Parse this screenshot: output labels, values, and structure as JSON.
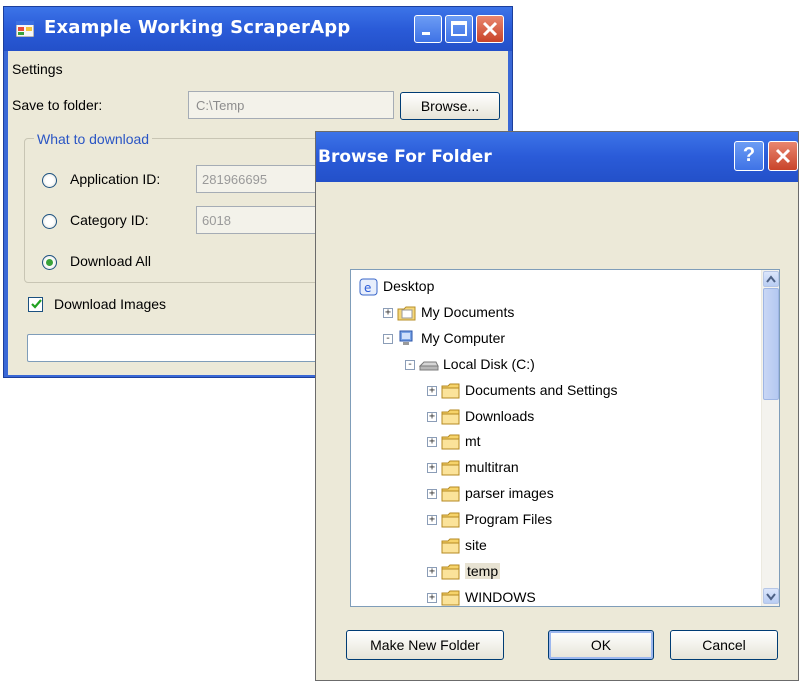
{
  "main_window": {
    "title": "Example Working ScraperApp",
    "menu": {
      "settings": "Settings"
    },
    "save_label": "Save to folder:",
    "save_value": "C:\\Temp",
    "browse_label": "Browse...",
    "group_title": "What to download",
    "options": [
      {
        "label": "Application ID:",
        "value": "281966695",
        "checked": false
      },
      {
        "label": "Category ID:",
        "value": "6018",
        "checked": false
      },
      {
        "label": "Download All",
        "checked": true
      }
    ],
    "download_images_label": "Download Images",
    "download_images_checked": true
  },
  "dialog": {
    "title": "Browse For Folder",
    "help": "?",
    "tree": [
      {
        "label": "Desktop",
        "icon": "desktop-icon",
        "depth": 0,
        "expander": ""
      },
      {
        "label": "My Documents",
        "icon": "my-documents-icon",
        "depth": 1,
        "expander": "+"
      },
      {
        "label": "My Computer",
        "icon": "my-computer-icon",
        "depth": 1,
        "expander": "-"
      },
      {
        "label": "Local Disk (C:)",
        "icon": "drive-icon",
        "depth": 2,
        "expander": "-"
      },
      {
        "label": "Documents and Settings",
        "icon": "folder-icon",
        "depth": 3,
        "expander": "+"
      },
      {
        "label": "Downloads",
        "icon": "folder-icon",
        "depth": 3,
        "expander": "+"
      },
      {
        "label": "mt",
        "icon": "folder-icon",
        "depth": 3,
        "expander": "+"
      },
      {
        "label": "multitran",
        "icon": "folder-icon",
        "depth": 3,
        "expander": "+"
      },
      {
        "label": "parser images",
        "icon": "folder-icon",
        "depth": 3,
        "expander": "+"
      },
      {
        "label": "Program Files",
        "icon": "folder-icon",
        "depth": 3,
        "expander": "+"
      },
      {
        "label": "site",
        "icon": "folder-icon",
        "depth": 3,
        "expander": ""
      },
      {
        "label": "temp",
        "icon": "folder-icon",
        "depth": 3,
        "expander": "+",
        "selected": true
      },
      {
        "label": "WINDOWS",
        "icon": "folder-icon",
        "depth": 3,
        "expander": "+"
      }
    ],
    "make_new_folder": "Make New Folder",
    "ok": "OK",
    "cancel": "Cancel"
  },
  "colors": {
    "xp_blue": "#2a5bd8",
    "window_face": "#ece9d8",
    "close_red": "#c8442a",
    "group_title_blue": "#2a55c4"
  }
}
